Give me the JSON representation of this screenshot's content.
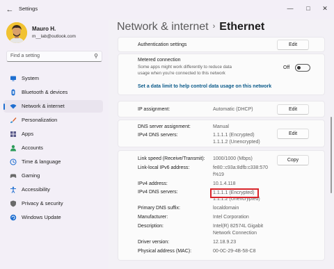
{
  "titlebar": {
    "app_title": "Settings",
    "back_icon": "arrow-left",
    "minimize_icon": "minimize",
    "maximize_icon": "maximize",
    "close_icon": "close"
  },
  "user": {
    "name": "Mauro H.",
    "email": "m__lab@outlook.com"
  },
  "search": {
    "placeholder": "Find a setting"
  },
  "nav": [
    {
      "label": "System",
      "icon": "monitor-icon",
      "color": "#1f6fd0"
    },
    {
      "label": "Bluetooth & devices",
      "icon": "bluetooth-icon",
      "color": "#1f6fd0"
    },
    {
      "label": "Network & internet",
      "icon": "wifi-icon",
      "color": "#1f6fd0",
      "active": true
    },
    {
      "label": "Personalization",
      "icon": "brush-icon",
      "color": "#d9612a"
    },
    {
      "label": "Apps",
      "icon": "apps-icon",
      "color": "#5a5a8a"
    },
    {
      "label": "Accounts",
      "icon": "person-icon",
      "color": "#2e9c5a"
    },
    {
      "label": "Time & language",
      "icon": "globe-clock-icon",
      "color": "#1f6fd0"
    },
    {
      "label": "Gaming",
      "icon": "controller-icon",
      "color": "#6a6a6a"
    },
    {
      "label": "Accessibility",
      "icon": "accessibility-icon",
      "color": "#1f6fd0"
    },
    {
      "label": "Privacy & security",
      "icon": "shield-icon",
      "color": "#6a6a6a"
    },
    {
      "label": "Windows Update",
      "icon": "update-icon",
      "color": "#1f6fd0"
    }
  ],
  "breadcrumb": {
    "parent": "Network & internet",
    "separator": "›",
    "current": "Ethernet"
  },
  "auth": {
    "label": "Authentication settings",
    "button": "Edit"
  },
  "metered": {
    "title": "Metered connection",
    "desc_line1": "Some apps might work differently to reduce data",
    "desc_line2": "usage when you're connected to this network",
    "state": "Off",
    "on": false,
    "link": "Set a data limit to help control data usage on this network"
  },
  "ip_assign": {
    "label": "IP assignment:",
    "value": "Automatic (DHCP)",
    "button": "Edit"
  },
  "dns_assign": {
    "label1": "DNS server assignment:",
    "value1": "Manual",
    "label2": "IPv4 DNS servers:",
    "value2a": "1.1.1.1 (Encrypted)",
    "value2b": "1.1.1.2 (Unencrypted)",
    "button": "Edit"
  },
  "props": {
    "copy_button": "Copy",
    "link_speed_label": "Link speed (Receive/Transmit):",
    "link_speed_value": "1000/1000 (Mbps)",
    "ipv6_label": "Link-local IPv6 address:",
    "ipv6_value1": "fe80::c93a:8dfb:c338:570",
    "ipv6_value2": "f%19",
    "ipv4_label": "IPv4 address:",
    "ipv4_value": "10.1.4.118",
    "dns_label": "IPv4 DNS servers:",
    "dns_value1": "1.1.1.1 (Encrypted)",
    "dns_value2": "1.1.1.2 (Unencrypted)",
    "suffix_label": "Primary DNS suffix:",
    "suffix_value": "localdomain",
    "mfr_label": "Manufacturer:",
    "mfr_value": "Intel Corporation",
    "desc_label": "Description:",
    "desc_value1": "Intel(R) 82574L Gigabit",
    "desc_value2": "Network Connection",
    "driver_label": "Driver version:",
    "driver_value": "12.18.9.23",
    "mac_label": "Physical address (MAC):",
    "mac_value": "00-0C-29-4B-58-C8"
  },
  "colors": {
    "accent": "#1f6fd0",
    "highlight": "#d9252a",
    "link": "#0a5a8a"
  }
}
